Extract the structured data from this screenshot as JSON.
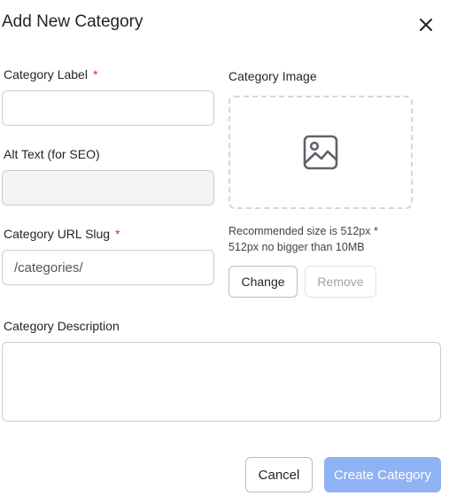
{
  "dialog": {
    "title": "Add New Category"
  },
  "fields": {
    "category_label": {
      "label": "Category Label",
      "required_mark": "*",
      "value": ""
    },
    "alt_text": {
      "label": "Alt Text (for SEO)",
      "value": ""
    },
    "url_slug": {
      "label": "Category URL Slug",
      "required_mark": "*",
      "placeholder": "/categories/"
    },
    "description": {
      "label": "Category Description",
      "value": ""
    }
  },
  "image": {
    "label": "Category Image",
    "hint_line1": "Recommended size is 512px *",
    "hint_line2": "512px no bigger than 10MB",
    "change_label": "Change",
    "remove_label": "Remove"
  },
  "footer": {
    "cancel_label": "Cancel",
    "create_label": "Create Category"
  },
  "colors": {
    "required": "#d93025",
    "primary_disabled": "#8fb2f4"
  }
}
